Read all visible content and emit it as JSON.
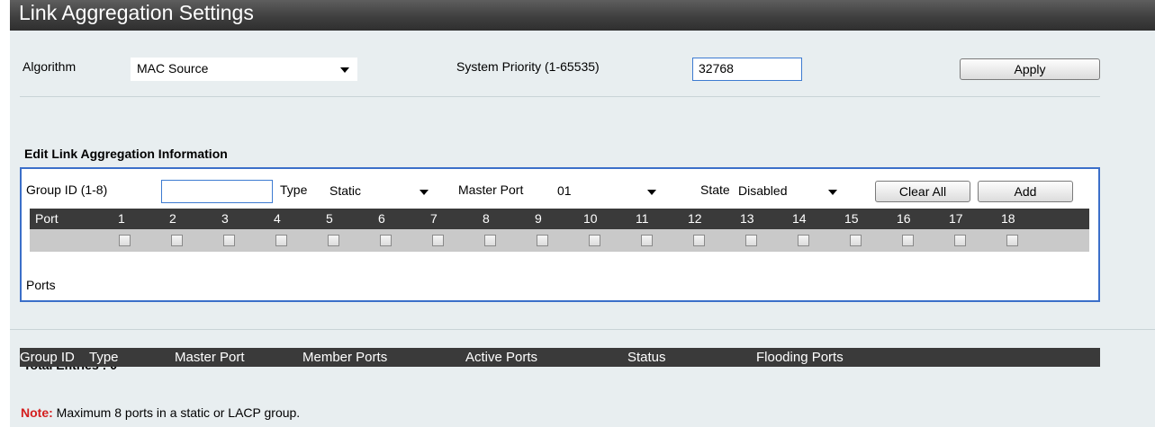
{
  "title": "Link Aggregation Settings",
  "algorithm": {
    "label": "Algorithm",
    "value": "MAC Source"
  },
  "system_priority": {
    "label": "System Priority (1-65535)",
    "value": "32768"
  },
  "apply_label": "Apply",
  "edit": {
    "heading": "Edit Link Aggregation Information",
    "group_id_label": "Group ID (1-8)",
    "group_id_value": "",
    "type_label": "Type",
    "type_value": "Static",
    "master_port_label": "Master Port",
    "master_port_value": "01",
    "state_label": "State",
    "state_value": "Disabled",
    "clear_all_label": "Clear All",
    "add_label": "Add",
    "port_header": "Port",
    "ports": [
      "1",
      "2",
      "3",
      "4",
      "5",
      "6",
      "7",
      "8",
      "9",
      "10",
      "11",
      "12",
      "13",
      "14",
      "15",
      "16",
      "17",
      "18"
    ],
    "ports_row_label": "Ports"
  },
  "total_entries": "Total Entries : 0",
  "table_columns": [
    "Group ID",
    "Type",
    "Master Port",
    "Member Ports",
    "Active Ports",
    "Status",
    "Flooding Ports"
  ],
  "note": {
    "label": "Note:",
    "text": "Maximum 8 ports in a static or LACP group."
  }
}
